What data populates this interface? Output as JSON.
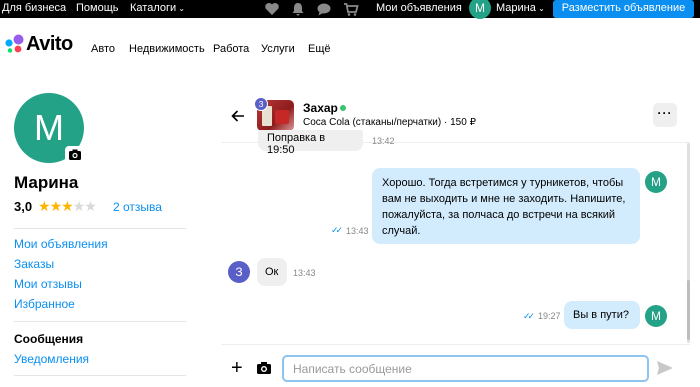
{
  "topbar": {
    "for_business": "Для бизнеса",
    "help": "Помощь",
    "catalogs": "Каталоги",
    "my_ads": "Мои объявления",
    "user_initial": "М",
    "user_name": "Марина",
    "post_ad": "Разместить объявление",
    "icons": [
      "heart-icon",
      "bell-icon",
      "chat-icon",
      "cart-icon"
    ]
  },
  "nav": {
    "logo": "Avito",
    "items": [
      "Авто",
      "Недвижимость",
      "Работа",
      "Услуги",
      "Ещё"
    ]
  },
  "profile": {
    "initial": "М",
    "name": "Марина",
    "rating": "3,0",
    "stars_filled": 3,
    "stars_total": 5,
    "reviews": "2 отзыва"
  },
  "sidebar": {
    "links": [
      "Мои объявления",
      "Заказы",
      "Мои отзывы",
      "Избранное"
    ],
    "section": "Сообщения",
    "notifications": "Уведомления"
  },
  "chat": {
    "partner_initial": "З",
    "partner_name": "Захар",
    "item_line": "Coca Cola (стаканы/перчатки) · 150 ₽",
    "more": "···",
    "messages": [
      {
        "dir": "in",
        "text": "Поправка в 19:50",
        "time": "13:42"
      },
      {
        "dir": "out",
        "text": "Хорошо. Тогда встретимся у турникетов, чтобы вам не выходить и мне не заходить. Напишите, пожалуйста, за полчаса до встречи на всякий случай.",
        "time": "13:43",
        "avatar": "М"
      },
      {
        "dir": "in",
        "text": "Ок",
        "time": "13:43",
        "avatar": "З"
      },
      {
        "dir": "out",
        "text": "Вы в пути?",
        "time": "19:27",
        "avatar": "М"
      }
    ],
    "placeholder": "Написать сообщение"
  },
  "colors": {
    "accent": "#0a8ff0",
    "avatar_green": "#23a287",
    "avatar_purple": "#5a5fc8",
    "bubble_out": "#d3ecfd",
    "bubble_in": "#efefef",
    "star": "#ffb400"
  }
}
